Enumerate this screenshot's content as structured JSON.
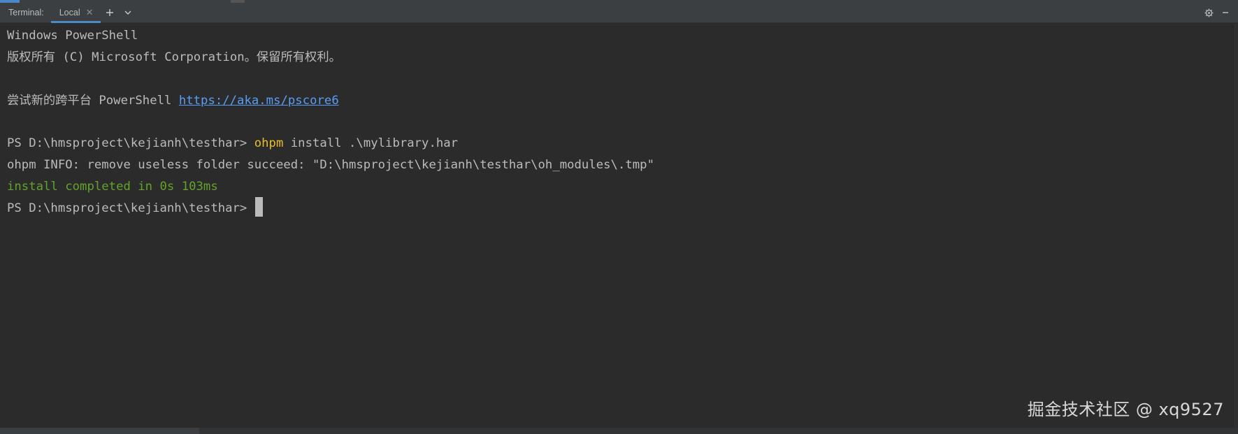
{
  "header": {
    "title": "Terminal:",
    "tab_label": "Local",
    "tab_close_icon": "close-icon",
    "add_icon": "plus-icon",
    "dropdown_icon": "chevron-down-icon",
    "settings_icon": "gear-icon",
    "minimize_icon": "minimize-icon"
  },
  "terminal": {
    "lines": {
      "l1": "Windows PowerShell",
      "l2": "版权所有 (C) Microsoft Corporation。保留所有权利。",
      "l4_prefix": "尝试新的跨平台 PowerShell ",
      "l4_link": "https://aka.ms/pscore6",
      "l6_prompt": "PS D:\\hmsproject\\kejianh\\testhar> ",
      "l6_cmd": "ohpm",
      "l6_args": " install .\\mylibrary.har",
      "l7": "ohpm INFO: remove useless folder succeed: \"D:\\hmsproject\\kejianh\\testhar\\oh_modules\\.tmp\"",
      "l8": "install completed in 0s 103ms",
      "l9_prompt": "PS D:\\hmsproject\\kejianh\\testhar>"
    }
  },
  "watermark": "掘金技术社区 @ xq9527",
  "colors": {
    "background": "#2b2b2b",
    "text": "#bbbbbb",
    "link": "#589df6",
    "command": "#e8bf2a",
    "success": "#62a32b",
    "accent": "#4a88c7"
  }
}
